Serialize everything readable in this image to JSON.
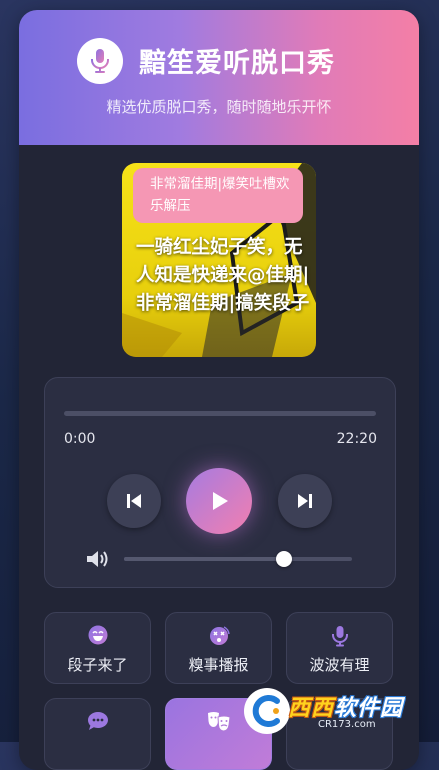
{
  "app": {
    "title": "黯笙爱听脱口秀",
    "subtitle": "精选优质脱口秀，随时随地乐开怀",
    "logo_icon": "microphone-icon"
  },
  "cover": {
    "tag": "非常溜佳期|爆笑吐槽欢乐解压",
    "text": "一骑红尘妃子笑，无人知是快递来@佳期|非常溜佳期|搞笑段子"
  },
  "player": {
    "current_time": "0:00",
    "total_time": "22:20",
    "progress": 0,
    "volume": 0.7,
    "buttons": {
      "prev_icon": "skip-previous-icon",
      "play_icon": "play-icon",
      "next_icon": "skip-next-icon",
      "volume_icon": "volume-icon"
    }
  },
  "categories": [
    {
      "label": "段子来了",
      "icon": "laugh-face-icon",
      "active": false
    },
    {
      "label": "糗事播报",
      "icon": "dizzy-face-icon",
      "active": false
    },
    {
      "label": "波波有理",
      "icon": "microphone-icon",
      "active": false
    },
    {
      "label": "",
      "icon": "comment-dots-icon",
      "active": false
    },
    {
      "label": "",
      "icon": "theater-masks-icon",
      "active": true
    },
    {
      "label": "",
      "icon": "",
      "active": false
    }
  ],
  "watermark": {
    "title_part1": "西西",
    "title_part2": "软件园",
    "url": "CR173.com"
  },
  "colors": {
    "accent_start": "#7a6ee0",
    "accent_end": "#f47fa6",
    "card_bg": "#222536",
    "panel_bg": "#2b2e42"
  }
}
